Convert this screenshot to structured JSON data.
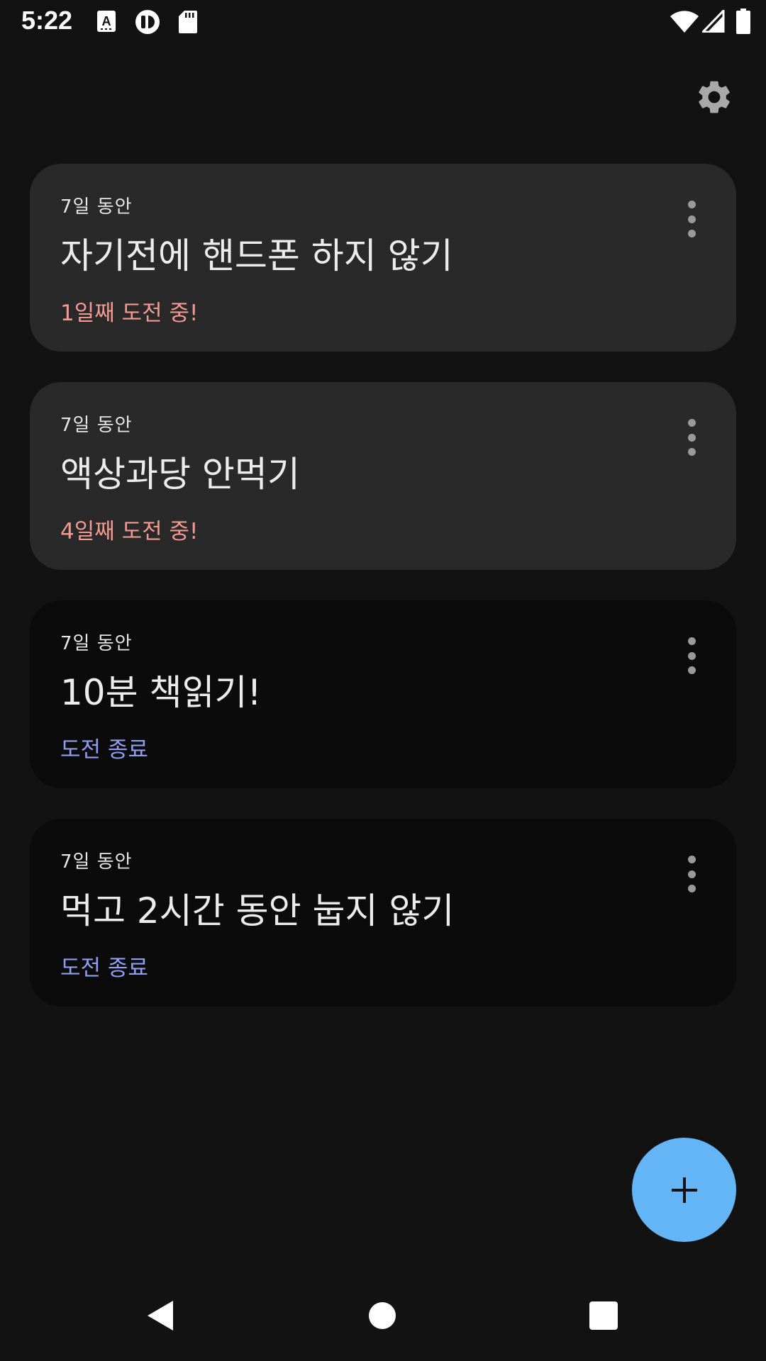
{
  "status_bar": {
    "time": "5:22",
    "icons": [
      "autofill-a-icon",
      "sync-circle-icon",
      "sd-card-icon",
      "wifi-icon",
      "signal-icon",
      "battery-icon"
    ]
  },
  "toolbar": {
    "settings_icon": "gear-icon"
  },
  "challenges": [
    {
      "duration": "7일 동안",
      "title": "자기전에 핸드폰 하지 않기",
      "status": "1일째 도전 중!",
      "state": "active",
      "menu_icon": "more-vert-icon"
    },
    {
      "duration": "7일 동안",
      "title": "액상과당 안먹기",
      "status": "4일째 도전 중!",
      "state": "active",
      "menu_icon": "more-vert-icon"
    },
    {
      "duration": "7일 동안",
      "title": "10분 책읽기!",
      "status": "도전 종료",
      "state": "ended",
      "menu_icon": "more-vert-icon"
    },
    {
      "duration": "7일 동안",
      "title": "먹고 2시간 동안 눕지 않기",
      "status": "도전 종료",
      "state": "ended",
      "menu_icon": "more-vert-icon"
    }
  ],
  "fab": {
    "icon": "plus-icon",
    "color": "#64b5f6"
  },
  "colors": {
    "background": "#121212",
    "active_card": "#292929",
    "ended_card": "#0b0b0b",
    "active_status": "#f29a92",
    "ended_status": "#8f9ef0"
  },
  "nav_bar": {
    "back_icon": "back-triangle-icon",
    "home_icon": "home-circle-icon",
    "recents_icon": "recents-square-icon"
  }
}
